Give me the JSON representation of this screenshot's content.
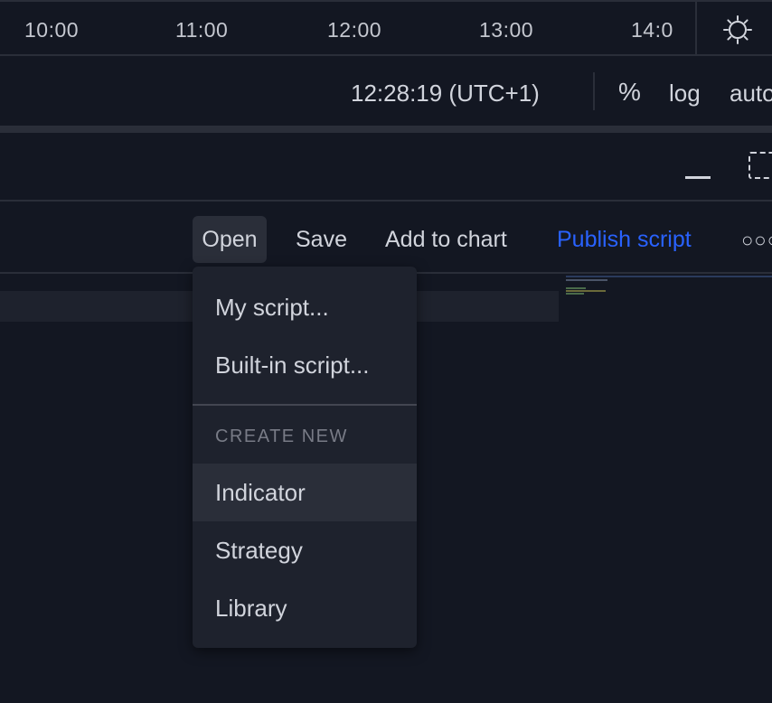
{
  "time_axis": {
    "labels": [
      "10:00",
      "11:00",
      "12:00",
      "13:00",
      "14:0"
    ],
    "settings_icon": "gear-icon"
  },
  "status_bar": {
    "time": "12:28:19 (UTC+1)",
    "percent": "%",
    "log": "log",
    "auto": "auto"
  },
  "panel_header": {
    "minimize_icon": "minimize-icon",
    "maximize_icon": "maximize-icon"
  },
  "toolbar": {
    "open": "Open",
    "save": "Save",
    "add_to_chart": "Add to chart",
    "publish": "Publish script",
    "more_icon": "ellipsis-icon",
    "publish_color": "#2962ff"
  },
  "open_menu": {
    "items": [
      "My script...",
      "Built-in script..."
    ],
    "section_title": "CREATE NEW",
    "create_items": [
      "Indicator",
      "Strategy",
      "Library"
    ],
    "highlighted": "Indicator"
  },
  "colors": {
    "background": "#131722",
    "panel": "#1e222d",
    "border": "#2a2e39",
    "text": "#d1d4dc",
    "muted": "#787b86",
    "accent": "#2962ff"
  }
}
